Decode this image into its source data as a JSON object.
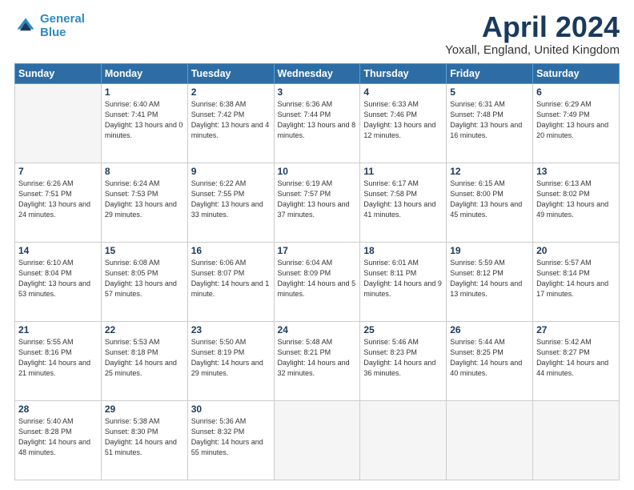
{
  "header": {
    "logo_line1": "General",
    "logo_line2": "Blue",
    "month": "April 2024",
    "location": "Yoxall, England, United Kingdom"
  },
  "weekdays": [
    "Sunday",
    "Monday",
    "Tuesday",
    "Wednesday",
    "Thursday",
    "Friday",
    "Saturday"
  ],
  "weeks": [
    [
      {
        "day": "",
        "sunrise": "",
        "sunset": "",
        "daylight": ""
      },
      {
        "day": "1",
        "sunrise": "6:40 AM",
        "sunset": "7:41 PM",
        "daylight": "13 hours and 0 minutes."
      },
      {
        "day": "2",
        "sunrise": "6:38 AM",
        "sunset": "7:42 PM",
        "daylight": "13 hours and 4 minutes."
      },
      {
        "day": "3",
        "sunrise": "6:36 AM",
        "sunset": "7:44 PM",
        "daylight": "13 hours and 8 minutes."
      },
      {
        "day": "4",
        "sunrise": "6:33 AM",
        "sunset": "7:46 PM",
        "daylight": "13 hours and 12 minutes."
      },
      {
        "day": "5",
        "sunrise": "6:31 AM",
        "sunset": "7:48 PM",
        "daylight": "13 hours and 16 minutes."
      },
      {
        "day": "6",
        "sunrise": "6:29 AM",
        "sunset": "7:49 PM",
        "daylight": "13 hours and 20 minutes."
      }
    ],
    [
      {
        "day": "7",
        "sunrise": "6:26 AM",
        "sunset": "7:51 PM",
        "daylight": "13 hours and 24 minutes."
      },
      {
        "day": "8",
        "sunrise": "6:24 AM",
        "sunset": "7:53 PM",
        "daylight": "13 hours and 29 minutes."
      },
      {
        "day": "9",
        "sunrise": "6:22 AM",
        "sunset": "7:55 PM",
        "daylight": "13 hours and 33 minutes."
      },
      {
        "day": "10",
        "sunrise": "6:19 AM",
        "sunset": "7:57 PM",
        "daylight": "13 hours and 37 minutes."
      },
      {
        "day": "11",
        "sunrise": "6:17 AM",
        "sunset": "7:58 PM",
        "daylight": "13 hours and 41 minutes."
      },
      {
        "day": "12",
        "sunrise": "6:15 AM",
        "sunset": "8:00 PM",
        "daylight": "13 hours and 45 minutes."
      },
      {
        "day": "13",
        "sunrise": "6:13 AM",
        "sunset": "8:02 PM",
        "daylight": "13 hours and 49 minutes."
      }
    ],
    [
      {
        "day": "14",
        "sunrise": "6:10 AM",
        "sunset": "8:04 PM",
        "daylight": "13 hours and 53 minutes."
      },
      {
        "day": "15",
        "sunrise": "6:08 AM",
        "sunset": "8:05 PM",
        "daylight": "13 hours and 57 minutes."
      },
      {
        "day": "16",
        "sunrise": "6:06 AM",
        "sunset": "8:07 PM",
        "daylight": "14 hours and 1 minute."
      },
      {
        "day": "17",
        "sunrise": "6:04 AM",
        "sunset": "8:09 PM",
        "daylight": "14 hours and 5 minutes."
      },
      {
        "day": "18",
        "sunrise": "6:01 AM",
        "sunset": "8:11 PM",
        "daylight": "14 hours and 9 minutes."
      },
      {
        "day": "19",
        "sunrise": "5:59 AM",
        "sunset": "8:12 PM",
        "daylight": "14 hours and 13 minutes."
      },
      {
        "day": "20",
        "sunrise": "5:57 AM",
        "sunset": "8:14 PM",
        "daylight": "14 hours and 17 minutes."
      }
    ],
    [
      {
        "day": "21",
        "sunrise": "5:55 AM",
        "sunset": "8:16 PM",
        "daylight": "14 hours and 21 minutes."
      },
      {
        "day": "22",
        "sunrise": "5:53 AM",
        "sunset": "8:18 PM",
        "daylight": "14 hours and 25 minutes."
      },
      {
        "day": "23",
        "sunrise": "5:50 AM",
        "sunset": "8:19 PM",
        "daylight": "14 hours and 29 minutes."
      },
      {
        "day": "24",
        "sunrise": "5:48 AM",
        "sunset": "8:21 PM",
        "daylight": "14 hours and 32 minutes."
      },
      {
        "day": "25",
        "sunrise": "5:46 AM",
        "sunset": "8:23 PM",
        "daylight": "14 hours and 36 minutes."
      },
      {
        "day": "26",
        "sunrise": "5:44 AM",
        "sunset": "8:25 PM",
        "daylight": "14 hours and 40 minutes."
      },
      {
        "day": "27",
        "sunrise": "5:42 AM",
        "sunset": "8:27 PM",
        "daylight": "14 hours and 44 minutes."
      }
    ],
    [
      {
        "day": "28",
        "sunrise": "5:40 AM",
        "sunset": "8:28 PM",
        "daylight": "14 hours and 48 minutes."
      },
      {
        "day": "29",
        "sunrise": "5:38 AM",
        "sunset": "8:30 PM",
        "daylight": "14 hours and 51 minutes."
      },
      {
        "day": "30",
        "sunrise": "5:36 AM",
        "sunset": "8:32 PM",
        "daylight": "14 hours and 55 minutes."
      },
      {
        "day": "",
        "sunrise": "",
        "sunset": "",
        "daylight": ""
      },
      {
        "day": "",
        "sunrise": "",
        "sunset": "",
        "daylight": ""
      },
      {
        "day": "",
        "sunrise": "",
        "sunset": "",
        "daylight": ""
      },
      {
        "day": "",
        "sunrise": "",
        "sunset": "",
        "daylight": ""
      }
    ]
  ]
}
